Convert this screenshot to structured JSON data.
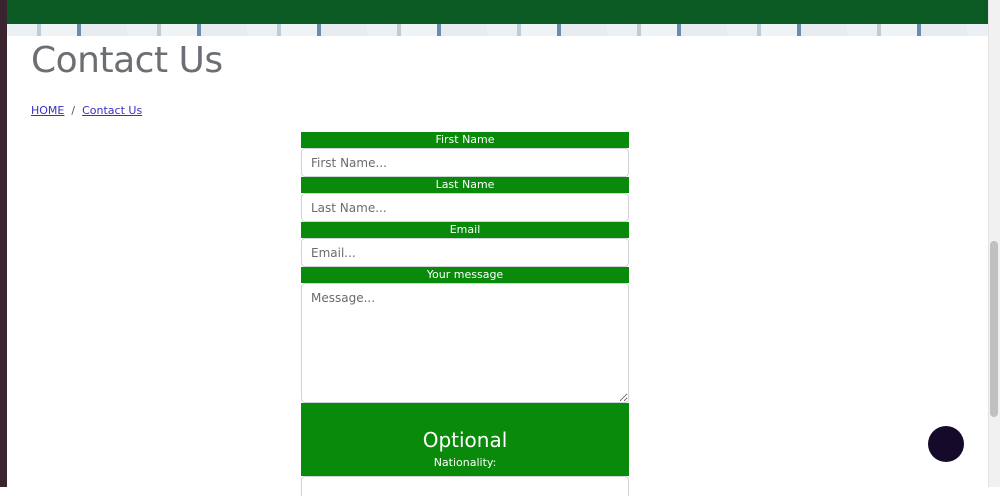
{
  "page": {
    "title": "Contact Us",
    "breadcrumb": {
      "home": "HOME",
      "separator": "/",
      "current": "Contact Us"
    }
  },
  "form": {
    "first_name": {
      "label": "First Name",
      "placeholder": "First Name...",
      "value": ""
    },
    "last_name": {
      "label": "Last Name",
      "placeholder": "Last Name...",
      "value": ""
    },
    "email": {
      "label": "Email",
      "placeholder": "Email...",
      "value": ""
    },
    "message": {
      "label": "Your message",
      "placeholder": "Message...",
      "value": ""
    },
    "optional": {
      "heading": "Optional",
      "nationality_label": "Nationality:"
    }
  },
  "colors": {
    "brand_green": "#0a8a0a",
    "banner_green": "#0b5a24",
    "chat_bubble": "#150a2a",
    "link": "#3a2fc6"
  },
  "icons": {
    "chat": "chat-bubble-icon"
  }
}
